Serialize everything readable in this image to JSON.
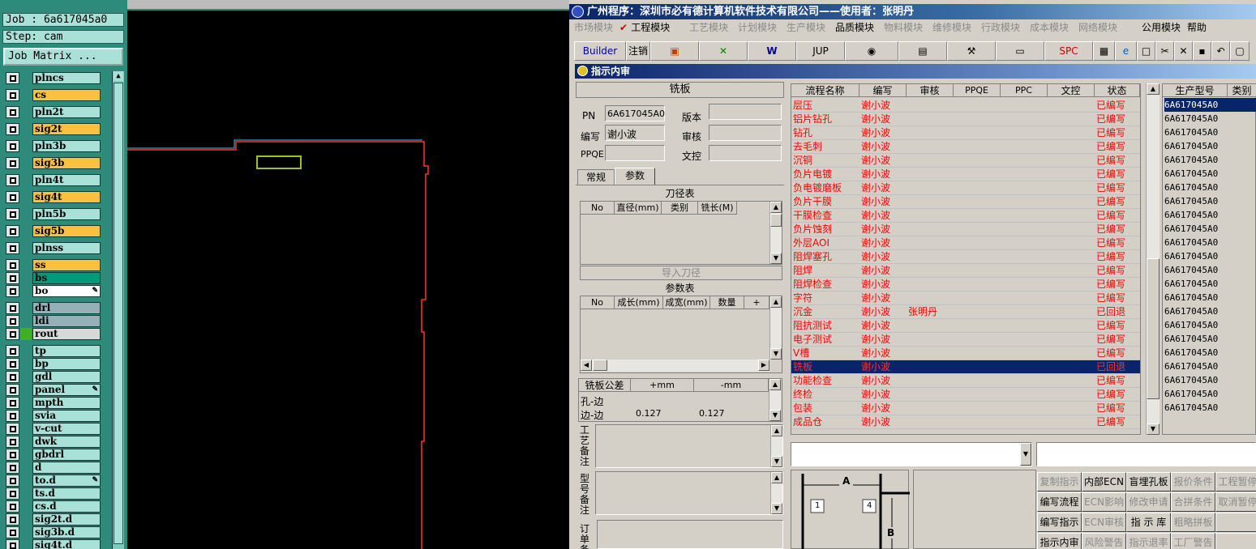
{
  "left_panel": {
    "job_label": "Job : 6a617045a0",
    "step_label": "Step: cam",
    "job_matrix_button": "Job Matrix ...",
    "layers": [
      {
        "name": "plncs",
        "color": "#a9e0d7",
        "locked": false
      },
      {
        "name": "cs",
        "color": "#fcc040",
        "locked": false
      },
      {
        "name": "pln2t",
        "color": "#a9e0d7",
        "locked": false
      },
      {
        "name": "sig2t",
        "color": "#fcc040",
        "locked": false
      },
      {
        "name": "pln3b",
        "color": "#a9e0d7",
        "locked": false
      },
      {
        "name": "sig3b",
        "color": "#fcc040",
        "locked": false
      },
      {
        "name": "pln4t",
        "color": "#a9e0d7",
        "locked": false
      },
      {
        "name": "sig4t",
        "color": "#fcc040",
        "locked": false
      },
      {
        "name": "pln5b",
        "color": "#a9e0d7",
        "locked": false
      },
      {
        "name": "sig5b",
        "color": "#fcc040",
        "locked": false
      },
      {
        "name": "plnss",
        "color": "#a9e0d7",
        "locked": false
      },
      {
        "name": "ss",
        "color": "#fcc040",
        "locked": false
      },
      {
        "name": "bs",
        "color": "#009a7a",
        "locked": false
      },
      {
        "name": "bo",
        "color": "#ffffff",
        "locked": true
      },
      {
        "name": "drl",
        "color": "#96b0b8",
        "locked": false
      },
      {
        "name": "ldi",
        "color": "#96b0b8",
        "locked": false
      },
      {
        "name": "rout",
        "color": "#d8d8d8",
        "locked": false
      },
      {
        "name": "tp",
        "color": "#a9e0d7",
        "locked": false
      },
      {
        "name": "bp",
        "color": "#a9e0d7",
        "locked": false
      },
      {
        "name": "gdl",
        "color": "#a9e0d7",
        "locked": false
      },
      {
        "name": "panel",
        "color": "#a9e0d7",
        "locked": true
      },
      {
        "name": "mpth",
        "color": "#a9e0d7",
        "locked": false
      },
      {
        "name": "svia",
        "color": "#a9e0d7",
        "locked": false
      },
      {
        "name": "v-cut",
        "color": "#a9e0d7",
        "locked": false
      },
      {
        "name": "dwk",
        "color": "#a9e0d7",
        "locked": false
      },
      {
        "name": "gbdrl",
        "color": "#a9e0d7",
        "locked": false
      },
      {
        "name": "d",
        "color": "#a9e0d7",
        "locked": false
      },
      {
        "name": "to.d",
        "color": "#a9e0d7",
        "locked": true
      },
      {
        "name": "ts.d",
        "color": "#a9e0d7",
        "locked": false
      },
      {
        "name": "cs.d",
        "color": "#a9e0d7",
        "locked": false
      },
      {
        "name": "sig2t.d",
        "color": "#a9e0d7",
        "locked": false
      },
      {
        "name": "sig3b.d",
        "color": "#a9e0d7",
        "locked": false
      },
      {
        "name": "sig4t.d",
        "color": "#a9e0d7",
        "locked": false
      }
    ]
  },
  "app": {
    "title": "广州程序：深圳市必有德计算机软件技术有限公司——使用者：张明丹",
    "menu": [
      {
        "label": "市场模块",
        "enabled": false
      },
      {
        "label": "工程模块",
        "enabled": true,
        "checked": true
      },
      {
        "label": "工艺模块",
        "enabled": false
      },
      {
        "label": "计划模块",
        "enabled": false
      },
      {
        "label": "生产模块",
        "enabled": false
      },
      {
        "label": "品质模块",
        "enabled": true
      },
      {
        "label": "物料模块",
        "enabled": false
      },
      {
        "label": "维修模块",
        "enabled": false
      },
      {
        "label": "行政模块",
        "enabled": false
      },
      {
        "label": "成本模块",
        "enabled": false
      },
      {
        "label": "网络模块",
        "enabled": false
      },
      {
        "label": "公用模块",
        "enabled": true
      },
      {
        "label": "帮助",
        "enabled": true
      }
    ],
    "toolbar": {
      "builder": "Builder",
      "logout": "注销",
      "jup": "JUP",
      "spc": "SPC"
    },
    "window_title": "指示内审",
    "form": {
      "section_title": "铣板",
      "pn_label": "PN",
      "pn_value": "6A617045A0",
      "version_label": "版本",
      "version_value": "",
      "writer_label": "编写",
      "writer_value": "谢小波",
      "reviewer_label": "审核",
      "reviewer_value": "",
      "ppqe_label": "PPQE",
      "ppqe_value": "",
      "doc_control_label": "文控",
      "doc_control_value": "",
      "tabs": [
        "常规",
        "参数"
      ],
      "active_tab": "参数",
      "tool_table_title": "刀径表",
      "tool_table_headers": [
        "No",
        "直径(mm)",
        "类别",
        "铣长(M)"
      ],
      "import_tool_button": "导入刀径",
      "param_table_title": "参数表",
      "param_table_headers": [
        "No",
        "成长(mm)",
        "成宽(mm)",
        "数量",
        "+"
      ],
      "tolerance_headers": [
        "铣板公差",
        "+mm",
        "-mm"
      ],
      "tolerance_rows": [
        {
          "label": "孔-边",
          "plus": "",
          "minus": ""
        },
        {
          "label": "边-边",
          "plus": "0.127",
          "minus": "0.127"
        }
      ],
      "process_remark_label": "工艺备注",
      "model_remark_label": "型号备注",
      "order_remark_label": "订单备"
    },
    "process_table": {
      "headers": [
        "流程名称",
        "编写",
        "审核",
        "PPQE",
        "PPC",
        "文控",
        "状态"
      ],
      "selected_index": 19,
      "rows": [
        {
          "name": "层压",
          "writer": "谢小波",
          "reviewer": "",
          "status": "已编写"
        },
        {
          "name": "铝片钻孔",
          "writer": "谢小波",
          "reviewer": "",
          "status": "已编写"
        },
        {
          "name": "钻孔",
          "writer": "谢小波",
          "reviewer": "",
          "status": "已编写"
        },
        {
          "name": "去毛刺",
          "writer": "谢小波",
          "reviewer": "",
          "status": "已编写"
        },
        {
          "name": "沉铜",
          "writer": "谢小波",
          "reviewer": "",
          "status": "已编写"
        },
        {
          "name": "负片电镀",
          "writer": "谢小波",
          "reviewer": "",
          "status": "已编写"
        },
        {
          "name": "负电镀磨板",
          "writer": "谢小波",
          "reviewer": "",
          "status": "已编写"
        },
        {
          "name": "负片干膜",
          "writer": "谢小波",
          "reviewer": "",
          "status": "已编写"
        },
        {
          "name": "干膜检查",
          "writer": "谢小波",
          "reviewer": "",
          "status": "已编写"
        },
        {
          "name": "负片蚀刻",
          "writer": "谢小波",
          "reviewer": "",
          "status": "已编写"
        },
        {
          "name": "外层AOI",
          "writer": "谢小波",
          "reviewer": "",
          "status": "已编写"
        },
        {
          "name": "阻焊塞孔",
          "writer": "谢小波",
          "reviewer": "",
          "status": "已编写"
        },
        {
          "name": "阻焊",
          "writer": "谢小波",
          "reviewer": "",
          "status": "已编写"
        },
        {
          "name": "阻焊检查",
          "writer": "谢小波",
          "reviewer": "",
          "status": "已编写"
        },
        {
          "name": "字符",
          "writer": "谢小波",
          "reviewer": "",
          "status": "已编写"
        },
        {
          "name": "沉金",
          "writer": "谢小波",
          "reviewer": "张明丹",
          "status": "已回退"
        },
        {
          "name": "阻抗测试",
          "writer": "谢小波",
          "reviewer": "",
          "status": "已编写"
        },
        {
          "name": "电子测试",
          "writer": "谢小波",
          "reviewer": "",
          "status": "已编写"
        },
        {
          "name": "V槽",
          "writer": "谢小波",
          "reviewer": "",
          "status": "已编写"
        },
        {
          "name": "铣板",
          "writer": "谢小波",
          "reviewer": "",
          "status": "已回退"
        },
        {
          "name": "功能检查",
          "writer": "谢小波",
          "reviewer": "",
          "status": "已编写"
        },
        {
          "name": "终检",
          "writer": "谢小波",
          "reviewer": "",
          "status": "已编写"
        },
        {
          "name": "包装",
          "writer": "谢小波",
          "reviewer": "",
          "status": "已编写"
        },
        {
          "name": "成品仓",
          "writer": "谢小波",
          "reviewer": "",
          "status": "已编写"
        }
      ]
    },
    "part_table": {
      "headers": [
        "生产型号",
        "类别"
      ],
      "rows": [
        "6A617045A0",
        "6A617045A0",
        "6A617045A0",
        "6A617045A0",
        "6A617045A0",
        "6A617045A0",
        "6A617045A0",
        "6A617045A0",
        "6A617045A0",
        "6A617045A0",
        "6A617045A0",
        "6A617045A0",
        "6A617045A0",
        "6A617045A0",
        "6A617045A0",
        "6A617045A0",
        "6A617045A0",
        "6A617045A0",
        "6A617045A0",
        "6A617045A0",
        "6A617045A0",
        "6A617045A0",
        "6A617045A0"
      ]
    },
    "diagram": {
      "label_a": "A",
      "label_b": "B",
      "label_1": "1",
      "label_4": "4"
    },
    "buttons": [
      [
        {
          "label": "复制指示",
          "enabled": false
        },
        {
          "label": "内部ECN",
          "enabled": true
        },
        {
          "label": "盲埋孔板",
          "enabled": true
        },
        {
          "label": "报价条件",
          "enabled": false
        },
        {
          "label": "工程暂停",
          "enabled": false
        }
      ],
      [
        {
          "label": "编写流程",
          "enabled": true
        },
        {
          "label": "ECN影响",
          "enabled": false
        },
        {
          "label": "修改申请",
          "enabled": false
        },
        {
          "label": "合拼条件",
          "enabled": false
        },
        {
          "label": "取消暂停",
          "enabled": false
        }
      ],
      [
        {
          "label": "编写指示",
          "enabled": true
        },
        {
          "label": "ECN审核",
          "enabled": false
        },
        {
          "label": "指 示 库",
          "enabled": true
        },
        {
          "label": "粗略拼板",
          "enabled": false
        },
        {
          "label": "",
          "enabled": false
        }
      ],
      [
        {
          "label": "指示内审",
          "enabled": true
        },
        {
          "label": "风险警告",
          "enabled": false
        },
        {
          "label": "指示退率",
          "enabled": false
        },
        {
          "label": "工厂警告",
          "enabled": false
        },
        {
          "label": "",
          "enabled": false
        }
      ]
    ]
  }
}
